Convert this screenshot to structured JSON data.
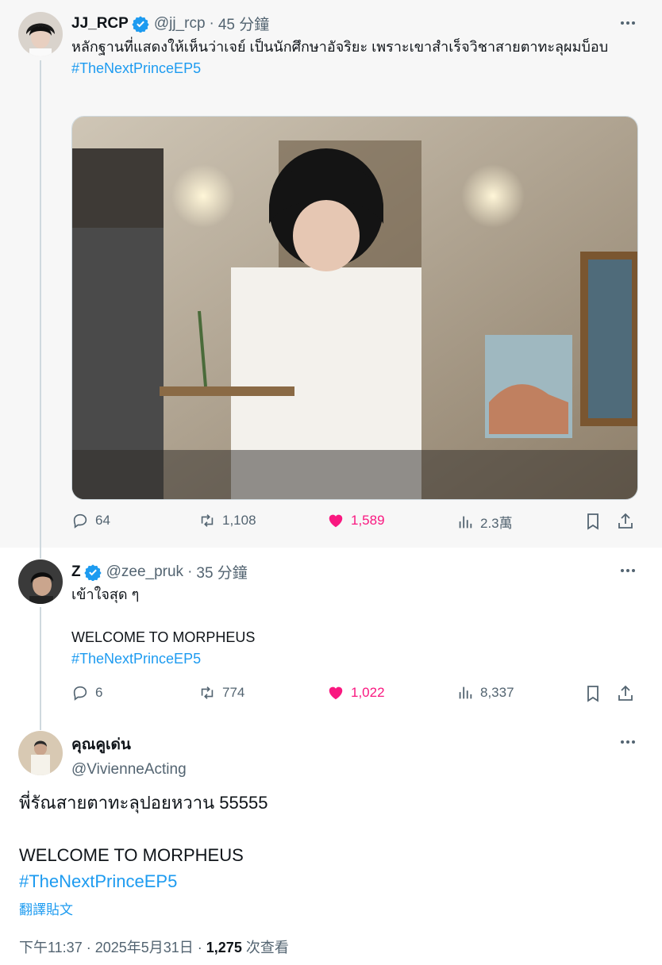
{
  "tweets": [
    {
      "name": "JJ_RCP",
      "handle": "@jj_rcp",
      "time": "45 分鐘",
      "text": "หลักฐานที่แสดงให้เห็นว่าเจย์ เป็นนักศึกษาอัจริยะ เพราะเขาสำเร็จวิชาสายตาทะลุผมบ็อบ",
      "hashtag": "#TheNextPrinceEP5",
      "replies": "64",
      "retweets": "1,108",
      "likes": "1,589",
      "views": "2.3萬"
    },
    {
      "name": "Z",
      "handle": "@zee_pruk",
      "time": "35 分鐘",
      "text1": "เข้าใจสุด ๆ",
      "text2": "WELCOME TO MORPHEUS",
      "hashtag": "#TheNextPrinceEP5",
      "replies": "6",
      "retweets": "774",
      "likes": "1,022",
      "views": "8,337"
    },
    {
      "name": "คุณคูเด่น",
      "handle": "@VivienneActing",
      "text1": "พี่รัณสายตาทะลุปอยหวาน 55555",
      "text2": "WELCOME TO MORPHEUS",
      "hashtag": "#TheNextPrinceEP5",
      "translate": "翻譯貼文",
      "meta_time": "下午11:37 · 2025年5月31日 · ",
      "meta_views": "1,275",
      "meta_views_label": " 次查看"
    }
  ],
  "separator": "·",
  "colors": {
    "accent": "#1d9bf0",
    "like": "#f91880",
    "muted": "#536471"
  },
  "icons": [
    "verified-badge-icon",
    "more-icon",
    "reply-icon",
    "retweet-icon",
    "heart-icon",
    "views-icon",
    "bookmark-icon",
    "share-icon"
  ]
}
